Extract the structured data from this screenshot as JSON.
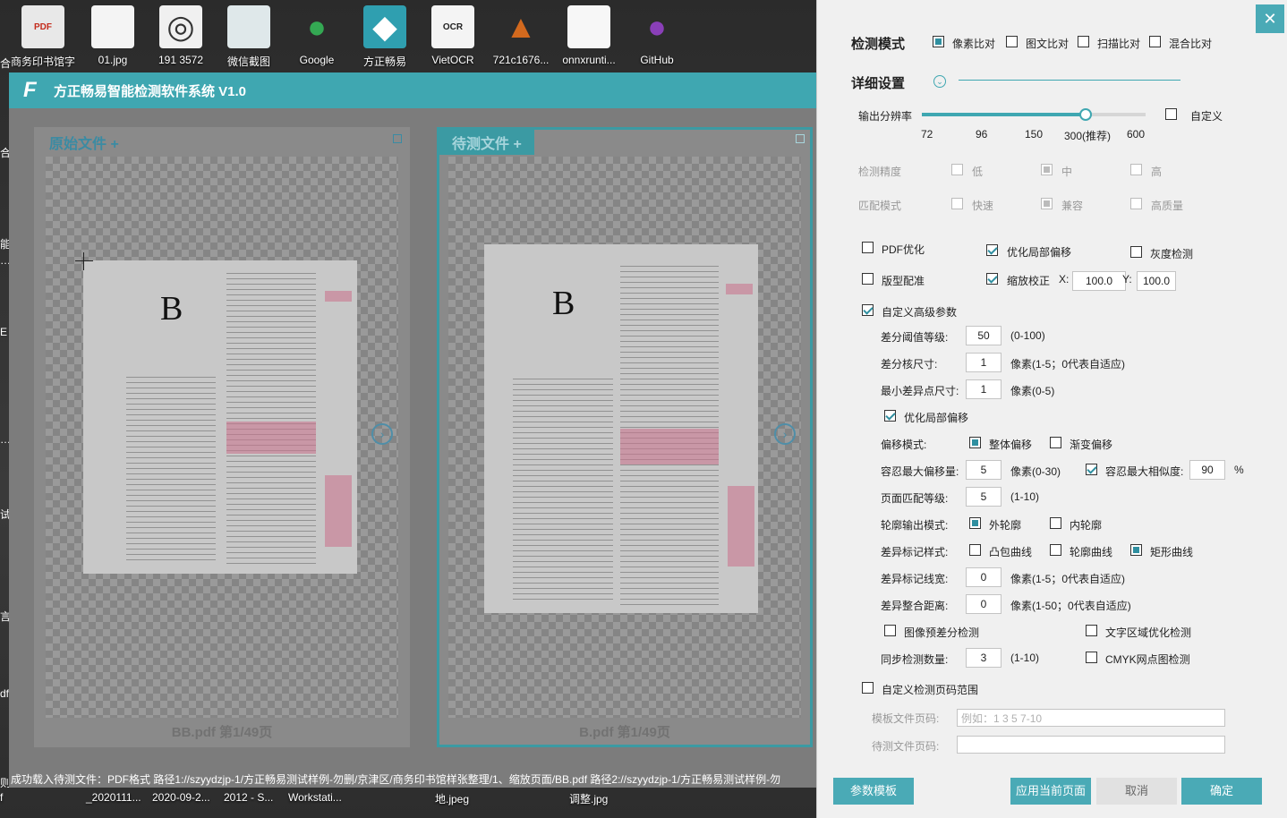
{
  "desktop": {
    "icons": [
      {
        "label": "商务印书馆字",
        "glyph": "PDF",
        "bg": "#e8e8e8",
        "fg": "#c42b1c"
      },
      {
        "label": "01.jpg",
        "glyph": "",
        "bg": "#f4f4f4",
        "fg": "#555"
      },
      {
        "label": "191 3572",
        "glyph": "◎",
        "bg": "#f0f0f0",
        "fg": "#333"
      },
      {
        "label": "微信截图",
        "glyph": "",
        "bg": "#dfe8ea",
        "fg": "#555"
      },
      {
        "label": "Google",
        "glyph": "●",
        "bg": "transparent",
        "fg": "#34a853"
      },
      {
        "label": "方正畅易",
        "glyph": "◆",
        "bg": "#2f9fb0",
        "fg": "#fff"
      },
      {
        "label": "VietOCR",
        "glyph": "OCR",
        "bg": "#f4f4f4",
        "fg": "#222"
      },
      {
        "label": "721c1676...",
        "glyph": "▲",
        "bg": "transparent",
        "fg": "#d2691e"
      },
      {
        "label": "onnxrunti...",
        "glyph": "",
        "bg": "#f7f7f7",
        "fg": "#555"
      },
      {
        "label": "GitHub",
        "glyph": "●",
        "bg": "transparent",
        "fg": "#8a3fb8"
      }
    ],
    "side_chars": [
      "合",
      "合",
      "能",
      "…",
      "E",
      "…",
      "试",
      "言",
      "df",
      "则"
    ],
    "taskbar": [
      "f",
      "_2020111...",
      "2020-09-2...",
      "2012 - S...",
      "Workstati...",
      "地.jpeg",
      "调整.jpg"
    ]
  },
  "app": {
    "title": "方正畅易智能检测软件系统 V1.0",
    "logo": "F",
    "left_panel": {
      "tab": "原始文件 +",
      "footer": "BB.pdf 第1/49页"
    },
    "right_panel": {
      "tab": "待测文件 +",
      "footer": "B.pdf 第1/49页"
    },
    "page_letter": "B",
    "nav_arrow": "›",
    "status": "成功载入待测文件：PDF格式    路径1://szyydzjp-1/方正畅易测试样例-勿删/京津区/商务印书馆样张整理/1、缩放页面/BB.pdf  路径2://szyydzjp-1/方正畅易测试样例-勿"
  },
  "settings": {
    "close": "✕",
    "mode_title": "检测模式",
    "modes": [
      "像素比对",
      "图文比对",
      "扫描比对",
      "混合比对"
    ],
    "detail_title": "详细设置",
    "chevron": "⌄",
    "resolution_label": "输出分辨率",
    "resolution_ticks": [
      "72",
      "96",
      "150",
      "300(推荐)",
      "600"
    ],
    "resolution_value": 0.73,
    "custom_label": "自定义",
    "precision_label": "检测精度",
    "precision_options": [
      "低",
      "中",
      "高"
    ],
    "match_label": "匹配模式",
    "match_options": [
      "快速",
      "兼容",
      "高质量"
    ],
    "pdf_opt": "PDF优化",
    "local_offset": "优化局部偏移",
    "gray_check": "灰度检测",
    "layout_match": "版型配准",
    "scale_correct": "缩放校正",
    "x_label": "X:",
    "x_value": "100.0",
    "y_label": "Y:",
    "y_value": "100.0",
    "advanced": "自定义高级参数",
    "diff_threshold_label": "差分阈值等级:",
    "diff_threshold_value": "50",
    "diff_threshold_hint": "(0-100)",
    "diff_kernel_label": "差分核尺寸:",
    "diff_kernel_value": "1",
    "diff_kernel_hint": "像素(1-5；0代表自适应)",
    "min_diff_label": "最小差异点尺寸:",
    "min_diff_value": "1",
    "min_diff_hint": "像素(0-5)",
    "local_offset2": "优化局部偏移",
    "offset_mode_label": "偏移模式:",
    "offset_whole": "整体偏移",
    "offset_gradual": "渐变偏移",
    "max_offset_label": "容忍最大偏移量:",
    "max_offset_value": "5",
    "max_offset_hint": "像素(0-30)",
    "max_sim_label": "容忍最大相似度:",
    "max_sim_value": "90",
    "max_sim_unit": "%",
    "page_match_label": "页面匹配等级:",
    "page_match_value": "5",
    "page_match_hint": "(1-10)",
    "contour_label": "轮廓输出模式:",
    "contour_outer": "外轮廓",
    "contour_inner": "内轮廓",
    "mark_style_label": "差异标记样式:",
    "mark_convex": "凸包曲线",
    "mark_contour": "轮廓曲线",
    "mark_rect": "矩形曲线",
    "mark_width_label": "差异标记线宽:",
    "mark_width_value": "0",
    "mark_width_hint": "像素(1-5；0代表自适应)",
    "merge_dist_label": "差异整合距离:",
    "merge_dist_value": "0",
    "merge_dist_hint": "像素(1-50；0代表自适应)",
    "pre_diff": "图像预差分检测",
    "text_opt": "文字区域优化检测",
    "sync_label": "同步检测数量:",
    "sync_value": "3",
    "sync_hint": "(1-10)",
    "cmyk": "CMYK网点图检测",
    "page_range": "自定义检测页码范围",
    "tpl_page_label": "模板文件页码:",
    "tpl_page_placeholder": "例如：1 3 5 7-10",
    "test_page_label": "待测文件页码:",
    "test_page_value": "",
    "buttons": {
      "template": "参数模板",
      "apply": "应用当前页面",
      "cancel": "取消",
      "ok": "确定"
    }
  }
}
